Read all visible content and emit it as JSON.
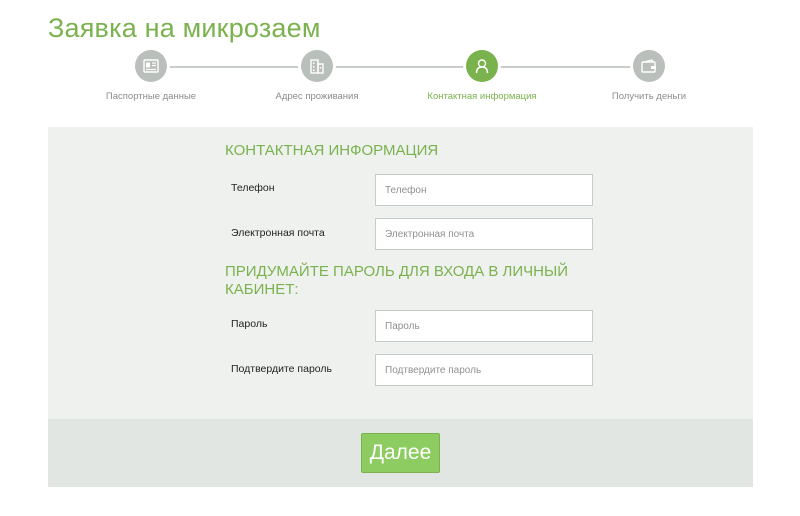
{
  "page": {
    "title": "Заявка на микрозаем"
  },
  "stepper": {
    "steps": [
      {
        "label": "Паспортные данные",
        "icon": "passport-icon",
        "active": false
      },
      {
        "label": "Адрес проживания",
        "icon": "building-icon",
        "active": false
      },
      {
        "label": "Контактная информация",
        "icon": "user-icon",
        "active": true
      },
      {
        "label": "Получить деньги",
        "icon": "wallet-icon",
        "active": false
      }
    ]
  },
  "form": {
    "contact_title": "КОНТАКТНАЯ ИНФОРМАЦИЯ",
    "phone": {
      "label": "Телефон",
      "placeholder": "Телефон",
      "value": ""
    },
    "email": {
      "label": "Электронная почта",
      "placeholder": "Электронная почта",
      "value": ""
    },
    "password_title": "ПРИДУМАЙТЕ ПАРОЛЬ ДЛЯ ВХОДА В ЛИЧНЫЙ КАБИНЕТ:",
    "password_title_line1": "ПРИДУМАЙТЕ ПАРОЛЬ ДЛЯ ВХОДА В ЛИЧНЫЙ",
    "password_title_line2": "КАБИНЕТ:",
    "password": {
      "label": "Пароль",
      "placeholder": "Пароль",
      "value": ""
    },
    "confirm_password": {
      "label": "Подтвердите пароль",
      "placeholder": "Подтвердите пароль",
      "value": ""
    }
  },
  "actions": {
    "next_label": "Далее"
  },
  "colors": {
    "accent": "#7ab24e",
    "button": "#8ccc61",
    "inactive_step": "#b9bfbb",
    "panel_bg": "#eef1ee",
    "footer_bg": "#e2e6e2"
  }
}
